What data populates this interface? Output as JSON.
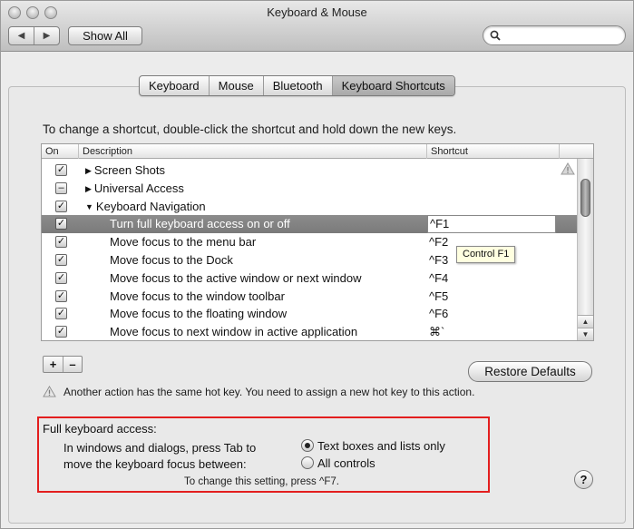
{
  "window": {
    "title": "Keyboard & Mouse",
    "back_glyph": "◀",
    "forward_glyph": "▶",
    "show_all_label": "Show All",
    "search_placeholder": "",
    "search_icon": "search-icon"
  },
  "tabs": [
    {
      "label": "Keyboard",
      "active": false
    },
    {
      "label": "Mouse",
      "active": false
    },
    {
      "label": "Bluetooth",
      "active": false
    },
    {
      "label": "Keyboard Shortcuts",
      "active": true
    }
  ],
  "instructions": "To change a shortcut, double-click the shortcut and hold down the new keys.",
  "table": {
    "headers": {
      "on": "On",
      "description": "Description",
      "shortcut": "Shortcut"
    },
    "rows": [
      {
        "checked": "✓",
        "disclosure": "▶",
        "description": "Screen Shots",
        "shortcut": "",
        "indent": 1
      },
      {
        "checked": "–",
        "disclosure": "▶",
        "description": "Universal Access",
        "shortcut": "",
        "indent": 1
      },
      {
        "checked": "✓",
        "disclosure": "▼",
        "description": "Keyboard Navigation",
        "shortcut": "",
        "indent": 1
      },
      {
        "checked": "✓",
        "disclosure": "",
        "description": "Turn full keyboard access on or off",
        "shortcut": "^F1",
        "indent": 2,
        "selected": true
      },
      {
        "checked": "✓",
        "disclosure": "",
        "description": "Move focus to the menu bar",
        "shortcut": "^F2",
        "indent": 2
      },
      {
        "checked": "✓",
        "disclosure": "",
        "description": "Move focus to the Dock",
        "shortcut": "^F3",
        "indent": 2
      },
      {
        "checked": "✓",
        "disclosure": "",
        "description": "Move focus to the active window or next window",
        "shortcut": "^F4",
        "indent": 2
      },
      {
        "checked": "✓",
        "disclosure": "",
        "description": "Move focus to the window toolbar",
        "shortcut": "^F5",
        "indent": 2
      },
      {
        "checked": "✓",
        "disclosure": "",
        "description": "Move focus to the floating window",
        "shortcut": "^F6",
        "indent": 2
      },
      {
        "checked": "✓",
        "disclosure": "",
        "description": "Move focus to next window in active application",
        "shortcut": "⌘`",
        "indent": 2
      }
    ],
    "tooltip": "Control F1"
  },
  "controls": {
    "add_label": "+",
    "remove_label": "–",
    "restore_label": "Restore Defaults",
    "warning_text": "Another action has the same hot key. You need to assign a new hot key to this action."
  },
  "full_keyboard_access": {
    "title": "Full keyboard access:",
    "line1": "In windows and dialogs, press Tab to",
    "line2": "move the keyboard focus between:",
    "option1": "Text boxes and lists only",
    "option2": "All controls",
    "selected": "option1",
    "note": "To change this setting, press ^F7."
  },
  "help_label": "?"
}
